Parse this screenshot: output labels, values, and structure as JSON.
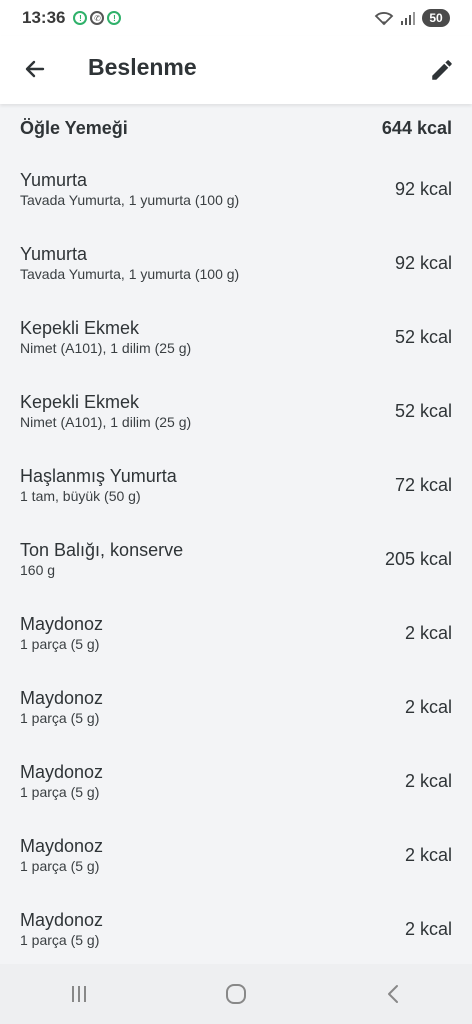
{
  "status_bar": {
    "time": "13:36",
    "battery": "50"
  },
  "app_bar": {
    "title": "Beslenme"
  },
  "meal": {
    "name": "Öğle Yemeği",
    "total": "644 kcal"
  },
  "items": [
    {
      "name": "Yumurta",
      "detail": "Tavada Yumurta, 1 yumurta (100 g)",
      "kcal": "92 kcal"
    },
    {
      "name": "Yumurta",
      "detail": "Tavada Yumurta, 1 yumurta (100 g)",
      "kcal": "92 kcal"
    },
    {
      "name": "Kepekli Ekmek",
      "detail": "Nimet (A101), 1 dilim (25 g)",
      "kcal": "52 kcal"
    },
    {
      "name": "Kepekli Ekmek",
      "detail": "Nimet (A101), 1 dilim (25 g)",
      "kcal": "52 kcal"
    },
    {
      "name": "Haşlanmış Yumurta",
      "detail": "1 tam, büyük (50 g)",
      "kcal": "72 kcal"
    },
    {
      "name": "Ton Balığı, konserve",
      "detail": "160 g",
      "kcal": "205 kcal"
    },
    {
      "name": "Maydonoz",
      "detail": "1 parça (5 g)",
      "kcal": "2 kcal"
    },
    {
      "name": "Maydonoz",
      "detail": "1 parça (5 g)",
      "kcal": "2 kcal"
    },
    {
      "name": "Maydonoz",
      "detail": "1 parça (5 g)",
      "kcal": "2 kcal"
    },
    {
      "name": "Maydonoz",
      "detail": "1 parça (5 g)",
      "kcal": "2 kcal"
    },
    {
      "name": "Maydonoz",
      "detail": "1 parça (5 g)",
      "kcal": "2 kcal"
    }
  ],
  "icons": {
    "back": "arrow-left-icon",
    "edit": "pencil-icon",
    "nav_recents": "recents-icon",
    "nav_home": "home-icon",
    "nav_back": "nav-back-icon"
  },
  "colors": {
    "background": "#f3f4f6",
    "surface": "#ffffff",
    "text": "#2f3437",
    "notif_green": "#2fb16a"
  }
}
